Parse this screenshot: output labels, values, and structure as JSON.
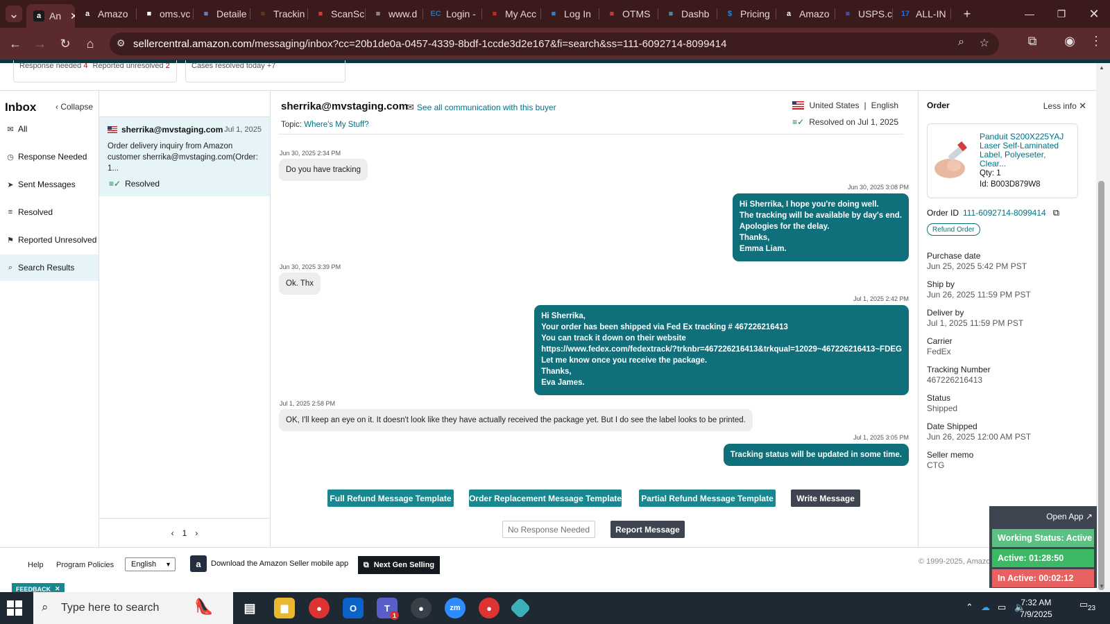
{
  "browser": {
    "tabs": [
      {
        "label": "An",
        "icon": "amazon-icon",
        "color": "#ffffff",
        "active": true
      },
      {
        "label": "Amazo",
        "icon": "amazon-icon",
        "color": "#ffffff"
      },
      {
        "label": "oms.vc",
        "icon": "triangle-icon",
        "color": "#ffffff"
      },
      {
        "label": "Detaile",
        "icon": "flag-icon",
        "color": "#5f7fbf"
      },
      {
        "label": "Trackin",
        "icon": "ups-icon",
        "color": "#5a3a1a"
      },
      {
        "label": "ScanSc",
        "icon": "scan-icon",
        "color": "#d9392b"
      },
      {
        "label": "www.d",
        "icon": "globe-icon",
        "color": "#888888"
      },
      {
        "label": "Login -",
        "icon": "ec-icon",
        "color": "#2a6fb0"
      },
      {
        "label": "My Acc",
        "icon": "logo-icon",
        "color": "#cc2222"
      },
      {
        "label": "Log In",
        "icon": "g-icon",
        "color": "#2b80d0"
      },
      {
        "label": "OTMS",
        "icon": "otms-icon",
        "color": "#c23b3b"
      },
      {
        "label": "Dashb",
        "icon": "diamond-icon",
        "color": "#3a8fb0"
      },
      {
        "label": "Pricing",
        "icon": "dollar-icon",
        "color": "#1e88e5"
      },
      {
        "label": "Amazo",
        "icon": "amazon-icon",
        "color": "#ffffff"
      },
      {
        "label": "USPS.c",
        "icon": "usps-icon",
        "color": "#3a4fa0"
      },
      {
        "label": "ALL-IN",
        "icon": "17-icon",
        "color": "#2d6fd6"
      }
    ],
    "url_host": "sellercentral.amazon.com",
    "url_path": "/messaging/inbox?cc=20b1de0a-0457-4339-8bdf-1ccde3d2e167&fi=search&ss=111-6092714-8099414"
  },
  "topcards": {
    "response_label": "Response needed",
    "response_count": "4",
    "reported_label": "Reported unresolved",
    "reported_count": "2",
    "cases_label": "Cases resolved today",
    "cases_count": "+7"
  },
  "sidebar": {
    "title": "Inbox",
    "collapse": "Collapse",
    "items": [
      {
        "label": "All",
        "icon": "mail-icon"
      },
      {
        "label": "Response Needed",
        "icon": "clock-icon"
      },
      {
        "label": "Sent Messages",
        "icon": "send-icon"
      },
      {
        "label": "Resolved",
        "icon": "resolved-icon"
      },
      {
        "label": "Reported Unresolved",
        "icon": "report-icon"
      },
      {
        "label": "Search Results",
        "icon": "search-icon",
        "selected": true
      }
    ]
  },
  "thread_list": {
    "email": "sherrika@mvstaging.com",
    "date": "Jul 1, 2025",
    "preview_1": "Order delivery inquiry from Amazon",
    "preview_2": "customer sherrika@mvstaging.com(Order:",
    "preview_3": "1...",
    "status": "Resolved",
    "page": "1"
  },
  "conversation": {
    "buyer_email": "sherrika@mvstaging.com",
    "see_all": "See all communication with this buyer",
    "topic_label": "Topic:",
    "topic": "Where's My Stuff?",
    "country": "United States",
    "language": "English",
    "resolved": "Resolved on Jul 1, 2025",
    "messages": [
      {
        "ts": "Jun 30, 2025 2:34 PM",
        "lines": [
          "Do you have tracking"
        ]
      },
      {
        "ts": "Jun 30, 2025 3:08 PM",
        "lines": [
          "Hi Sherrika, I hope you're doing well.",
          "The tracking will be available by day's end.",
          " Apologies for the delay.",
          "Thanks,",
          "Emma Liam."
        ]
      },
      {
        "ts": "Jun 30, 2025 3:39 PM",
        "lines": [
          "Ok. Thx"
        ]
      },
      {
        "ts": "Jul 1, 2025 2:42 PM",
        "lines": [
          "Hi Sherrika,",
          "Your order has been shipped via Fed Ex tracking # 467226216413",
          "You can track it down on their website",
          "https://www.fedex.com/fedextrack/?trknbr=467226216413&trkqual=12029~467226216413~FDEG",
          "Let me know once you receive the package.",
          "Thanks,",
          "Eva James."
        ]
      },
      {
        "ts": "Jul 1, 2025 2:58 PM",
        "lines": [
          "OK, I'll keep an eye on it. It doesn't look like they have actually received the package yet. But I do see the label looks to be printed."
        ]
      },
      {
        "ts": "Jul 1, 2025 3:05 PM",
        "lines": [
          "Tracking status will be updated in some time."
        ]
      }
    ],
    "buttons": {
      "full_refund": "Full Refund Message Template",
      "replacement": "Order Replacement Message Template",
      "partial_refund": "Partial Refund Message Template",
      "write": "Write Message",
      "no_response": "No Response Needed",
      "report": "Report Message"
    }
  },
  "order": {
    "title": "Order",
    "less_info": "Less info",
    "product_name": "Panduit S200X225YAJ Laser Self-Laminated Label, Polyeseter, Clear...",
    "qty": "Qty: 1",
    "id": "Id: B003D879W8",
    "order_id_label": "Order ID",
    "order_id": "111-6092714-8099414",
    "refund_button": "Refund Order",
    "fields": [
      {
        "label": "Purchase date",
        "value": "Jun 25, 2025 5:42 PM PST"
      },
      {
        "label": "Ship by",
        "value": "Jun 26, 2025 11:59 PM PST"
      },
      {
        "label": "Deliver by",
        "value": "Jul 1, 2025 11:59 PM PST"
      },
      {
        "label": "Carrier",
        "value": "FedEx"
      },
      {
        "label": "Tracking Number",
        "value": "467226216413"
      },
      {
        "label": "Status",
        "value": "Shipped"
      },
      {
        "label": "Date Shipped",
        "value": "Jun 26, 2025 12:00 AM PST"
      },
      {
        "label": "Seller memo",
        "value": "CTG"
      }
    ]
  },
  "footer": {
    "help": "Help",
    "policies": "Program Policies",
    "language": "English",
    "mobile": "Download the Amazon Seller mobile app",
    "nextgen": "Next Gen Selling",
    "copyright": "© 1999-2025, Amazon",
    "feedback": "FEEDBACK"
  },
  "widget": {
    "open_app": "Open App ↗",
    "working": "Working Status: Active",
    "active": "Active: 01:28:50",
    "inactive": "In Active: 00:02:12"
  },
  "taskbar": {
    "search_placeholder": "Type here to search",
    "time": "7:32 AM",
    "date": "7/9/2025",
    "notif_count": "23",
    "teams_badge": "1"
  }
}
